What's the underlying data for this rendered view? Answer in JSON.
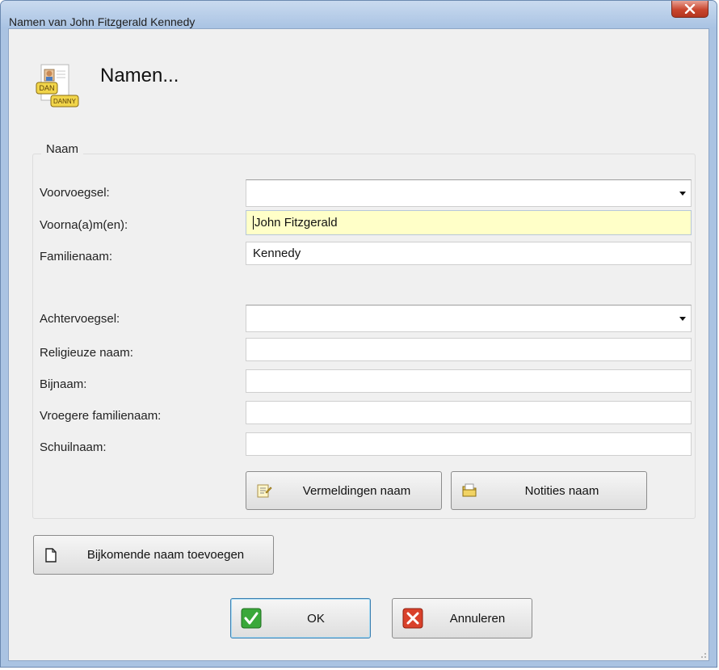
{
  "window": {
    "title": "Namen van John Fitzgerald Kennedy",
    "close_glyph": "✕"
  },
  "header": {
    "title": "Namen...",
    "icon": "names-card-icon",
    "icon_badge_1": "DAN",
    "icon_badge_2": "DANNY"
  },
  "group": {
    "legend": "Naam"
  },
  "fields": {
    "voorvoegsel": {
      "label": "Voorvoegsel:",
      "value": ""
    },
    "voornamen": {
      "label": "Voorna(a)m(en):",
      "value": "John Fitzgerald"
    },
    "familienaam": {
      "label": "Familienaam:",
      "value": "Kennedy"
    },
    "achtervoegsel": {
      "label": "Achtervoegsel:",
      "value": ""
    },
    "religieuze_naam": {
      "label": "Religieuze naam:",
      "value": ""
    },
    "bijnaam": {
      "label": "Bijnaam:",
      "value": ""
    },
    "vroegere_familienaam": {
      "label": "Vroegere familienaam:",
      "value": ""
    },
    "schuilnaam": {
      "label": "Schuilnaam:",
      "value": ""
    }
  },
  "buttons": {
    "vermeldingen": "Vermeldingen naam",
    "notities": "Notities naam",
    "bijkomende": "Bijkomende naam toevoegen",
    "ok": "OK",
    "annuleren": "Annuleren"
  },
  "colors": {
    "titlebar": "#b7cde8",
    "active_field": "#ffffc8",
    "ok_green": "#3aa83a",
    "cancel_red": "#d9412b"
  }
}
